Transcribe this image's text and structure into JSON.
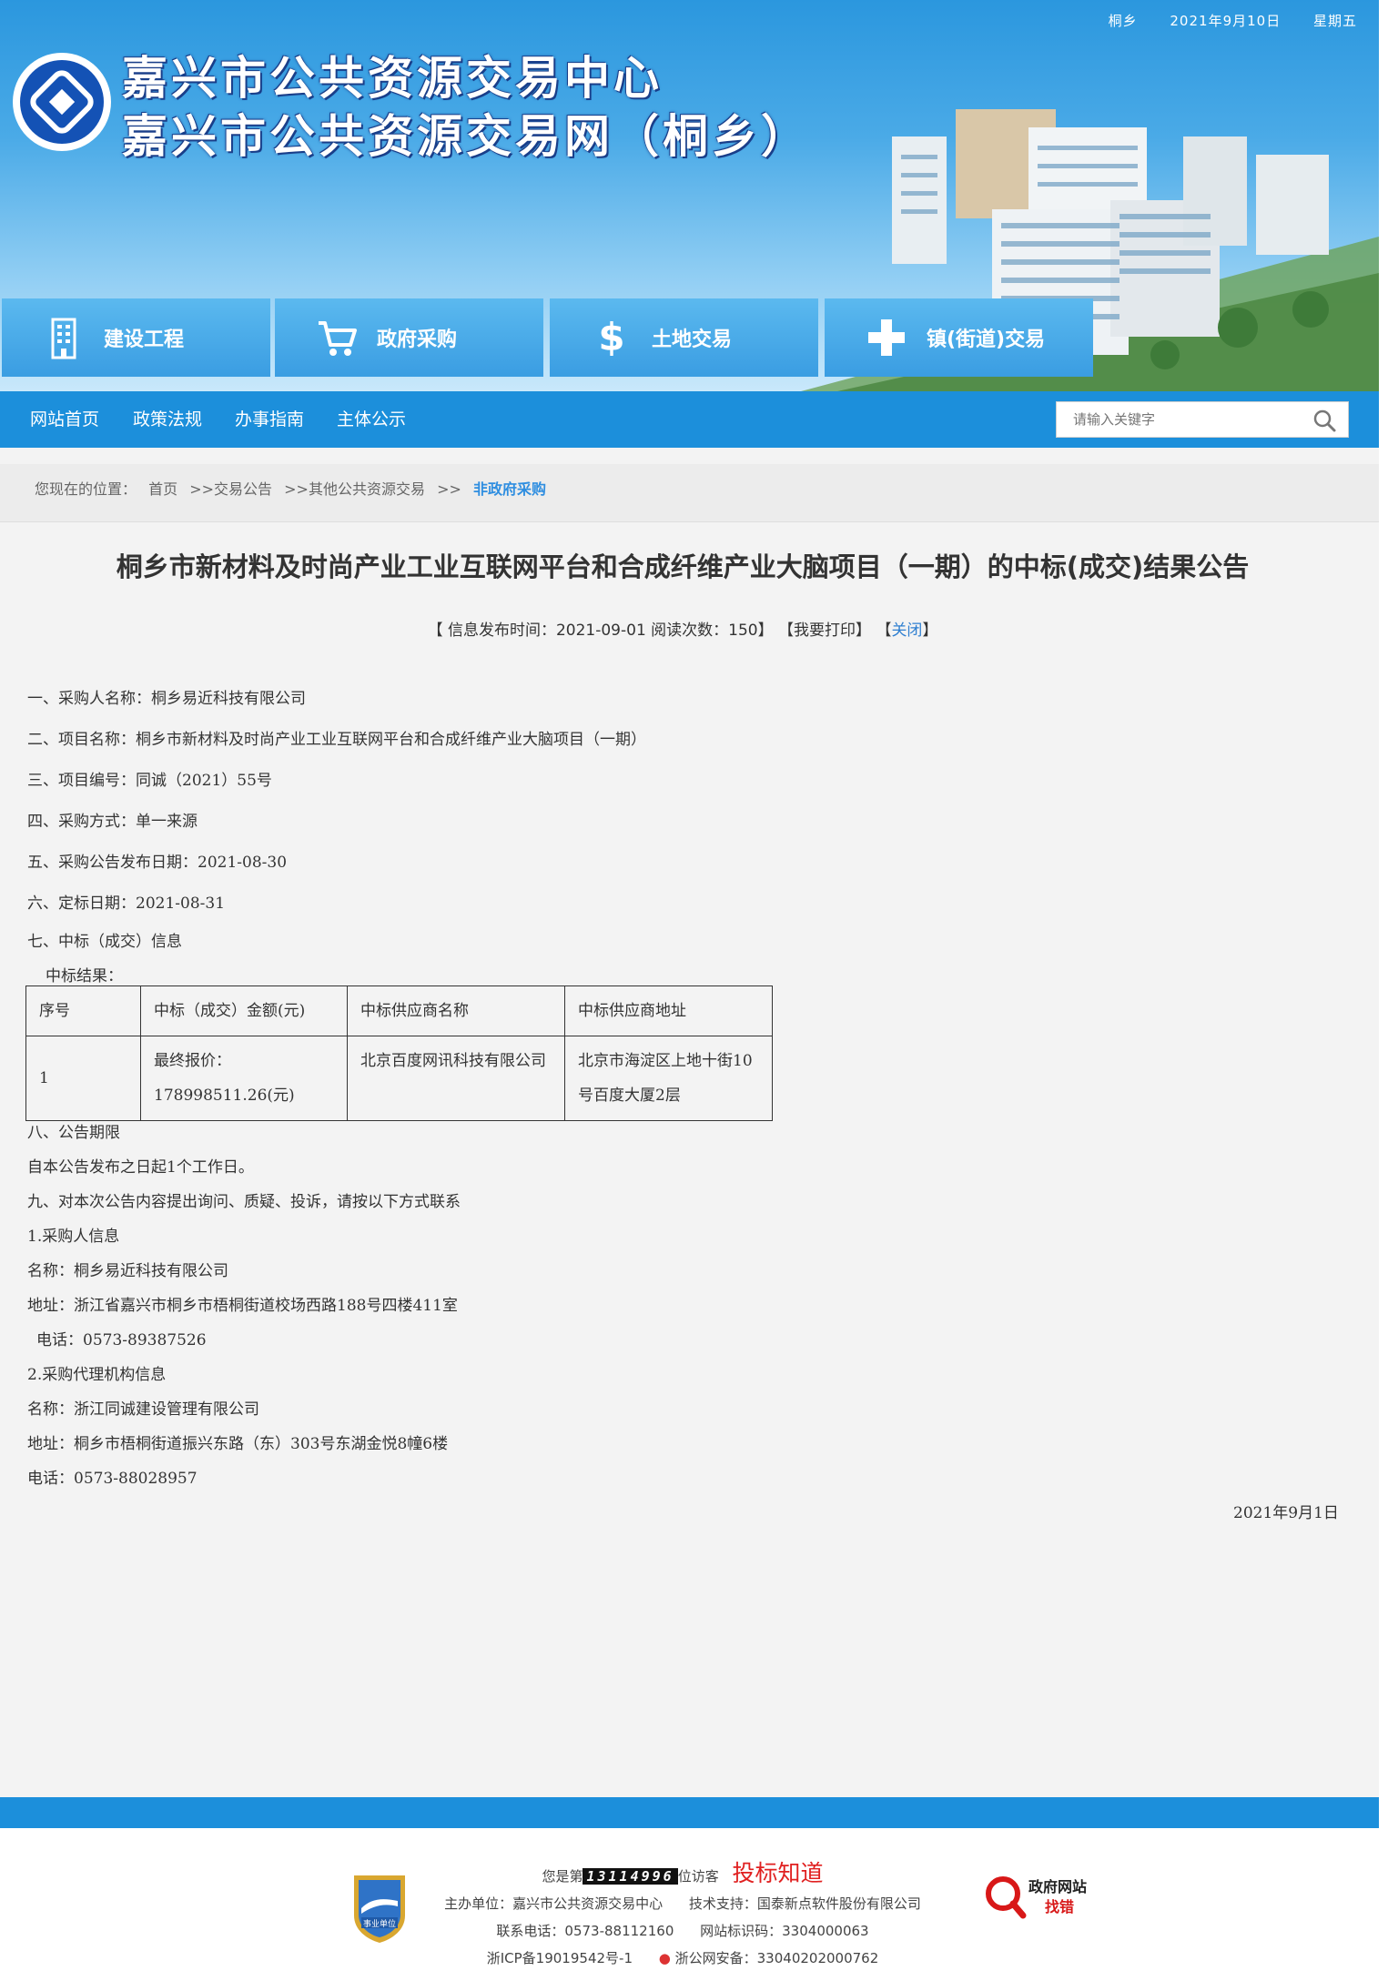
{
  "topbar": {
    "region": "桐乡",
    "date": "2021年9月10日",
    "weekday": "星期五"
  },
  "site": {
    "title_line1": "嘉兴市公共资源交易中心",
    "title_line2": "嘉兴市公共资源交易网（桐乡）"
  },
  "categories": [
    {
      "label": "建设工程",
      "icon": "building-icon"
    },
    {
      "label": "政府采购",
      "icon": "cart-icon"
    },
    {
      "label": "土地交易",
      "icon": "dollar-icon"
    },
    {
      "label": "镇(街道)交易",
      "icon": "plus-icon"
    }
  ],
  "nav": {
    "items": [
      "网站首页",
      "政策法规",
      "办事指南",
      "主体公示"
    ],
    "search_placeholder": "请输入关键字"
  },
  "breadcrumb": {
    "prefix": "您现在的位置：",
    "items": [
      "首页",
      ">>交易公告",
      ">>其他公共资源交易",
      ">>"
    ],
    "current": "非政府采购"
  },
  "article": {
    "title": "桐乡市新材料及时尚产业工业互联网平台和合成纤维产业大脑项目（一期）的中标(成交)结果公告",
    "meta_prefix": "【 信息发布时间：2021-09-01  阅读次数：150】",
    "print_label": "【我要打印】",
    "close_open": "【",
    "close_label": "关闭",
    "close_end": "】",
    "lines": [
      "一、采购人名称：桐乡易近科技有限公司",
      "二、项目名称：桐乡市新材料及时尚产业工业互联网平台和合成纤维产业大脑项目（一期）",
      "三、项目编号：同诚（2021）55号",
      "四、采购方式：单一来源",
      "五、采购公告发布日期：2021-08-30",
      "六、定标日期：2021-08-31",
      "七、中标（成交）信息",
      "中标结果："
    ],
    "table": {
      "headers": [
        "序号",
        "中标（成交）金额(元)",
        "中标供应商名称",
        "中标供应商地址"
      ],
      "row": [
        "1",
        "最终报价：178998511.26(元)",
        "北京百度网讯科技有限公司",
        "北京市海淀区上地十街10号百度大厦2层"
      ]
    },
    "lines2": [
      "八、公告期限",
      "自本公告发布之日起1个工作日。",
      "九、对本次公告内容提出询问、质疑、投诉，请按以下方式联系",
      "1.采购人信息",
      "名称：桐乡易近科技有限公司",
      "地址：浙江省嘉兴市桐乡市梧桐街道校场西路188号四楼411室",
      "电话：0573-89387526",
      "2.采购代理机构信息",
      "名称：浙江同诚建设管理有限公司",
      "地址：桐乡市梧桐街道振兴东路（东）303号东湖金悦8幢6楼",
      "电话：0573-88028957"
    ],
    "sign_date": "2021年9月1日"
  },
  "footer": {
    "visitor_prefix": "您是第",
    "visitor_count": "13114996",
    "visitor_suffix": "位访客",
    "brand": "投标知道",
    "host": "主办单位：嘉兴市公共资源交易中心",
    "support": "技术支持：国泰新点软件股份有限公司",
    "phone": "联系电话：0573-88112160",
    "site_id": "网站标识码：3304000063",
    "icp": "浙ICP备19019542号-1",
    "police": "浙公网安备：33040202000762",
    "badge_text": "事业单位",
    "zhaocuo_line1": "政府网站",
    "zhaocuo_line2": "找错"
  }
}
